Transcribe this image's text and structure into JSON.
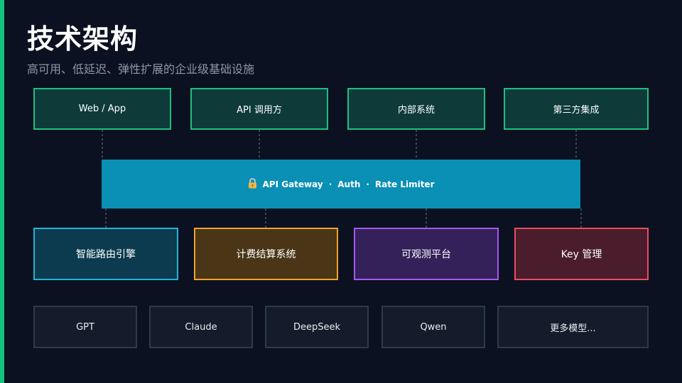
{
  "slide": {
    "title": "技术架构",
    "subtitle": "高可用、低延迟、弹性扩展的企业级基础设施"
  },
  "clients": [
    {
      "label": "Web / App"
    },
    {
      "label": "API 调用方"
    },
    {
      "label": "内部系统"
    },
    {
      "label": "第三方集成"
    }
  ],
  "gateway": {
    "icon": "lock-icon",
    "parts": [
      "API Gateway",
      "Auth",
      "Rate Limiter"
    ],
    "separator": "·"
  },
  "services": [
    {
      "label": "智能路由引擎"
    },
    {
      "label": "计费结算系统"
    },
    {
      "label": "可观测平台"
    },
    {
      "label": "Key 管理"
    }
  ],
  "models": [
    {
      "label": "GPT"
    },
    {
      "label": "Claude"
    },
    {
      "label": "DeepSeek"
    },
    {
      "label": "Qwen"
    },
    {
      "label": "更多模型..."
    }
  ],
  "colors": {
    "background": "#0b1120",
    "accent": "#13c07c",
    "gateway": "#0a8fb5",
    "routing": "#1fb6d6",
    "billing": "#f0a32e",
    "observability": "#a557f0",
    "key_management": "#ee4b60"
  }
}
